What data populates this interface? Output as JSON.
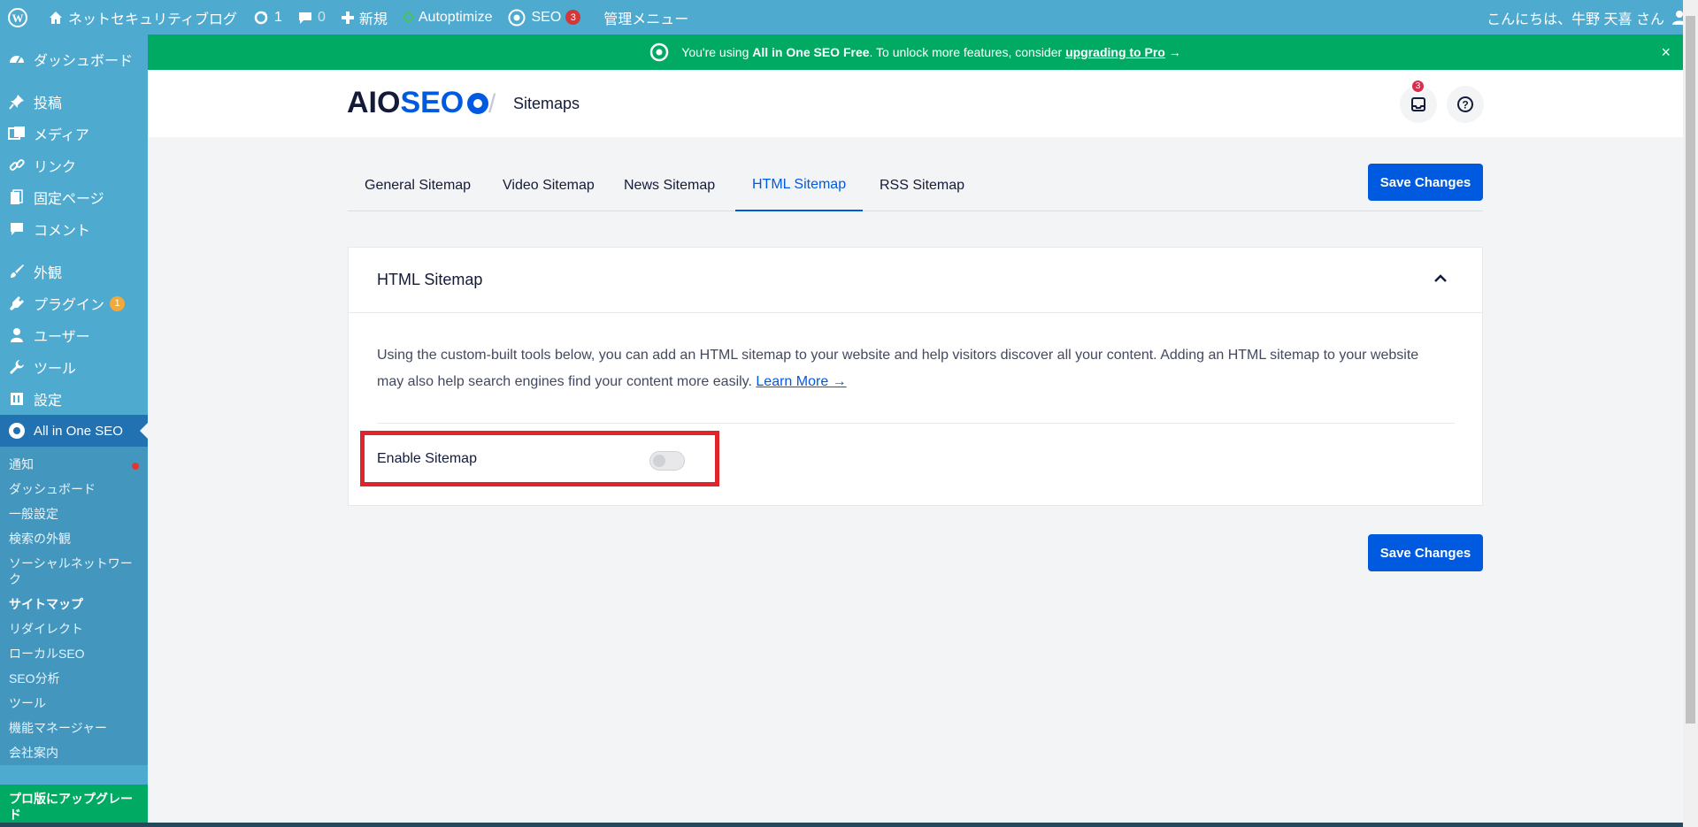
{
  "adminbar": {
    "site_name": "ネットセキュリティブログ",
    "updates_count": "1",
    "comments_count": "0",
    "new_label": "新規",
    "autoptimize_label": "Autoptimize",
    "seo_label": "SEO",
    "seo_badge": "3",
    "admin_menu_label": "管理メニュー",
    "greeting": "こんにちは、牛野 天喜 さん"
  },
  "sidebar": {
    "items": [
      {
        "label": "ダッシュボード",
        "icon": "dashboard-icon"
      },
      {
        "label": "投稿",
        "icon": "pin-icon"
      },
      {
        "label": "メディア",
        "icon": "media-icon"
      },
      {
        "label": "リンク",
        "icon": "link-icon"
      },
      {
        "label": "固定ページ",
        "icon": "page-icon"
      },
      {
        "label": "コメント",
        "icon": "comment-icon"
      },
      {
        "label": "外観",
        "icon": "brush-icon"
      },
      {
        "label": "プラグイン",
        "icon": "plugin-icon",
        "badge": "1"
      },
      {
        "label": "ユーザー",
        "icon": "user-icon"
      },
      {
        "label": "ツール",
        "icon": "wrench-icon"
      },
      {
        "label": "設定",
        "icon": "settings-icon"
      },
      {
        "label": "All in One SEO",
        "icon": "aioseo-icon"
      }
    ],
    "submenu": [
      "通知",
      "ダッシュボード",
      "一般設定",
      "検索の外観",
      "ソーシャルネットワーク",
      "サイトマップ",
      "リダイレクト",
      "ローカルSEO",
      "SEO分析",
      "ツール",
      "機能マネージャー",
      "会社案内"
    ],
    "upgrade_label": "プロ版にアップグレード"
  },
  "notice": {
    "prefix": "You're using ",
    "product": "All in One SEO Free",
    "middle": ". To unlock more features, consider ",
    "link": "upgrading to Pro",
    "arrow": " →",
    "close": "×"
  },
  "header": {
    "logo_aio": "AIO",
    "logo_seo": "SEO",
    "separator": "/",
    "title": "Sitemaps",
    "notifications_badge": "3"
  },
  "tabs": [
    "General Sitemap",
    "Video Sitemap",
    "News Sitemap",
    "HTML Sitemap",
    "RSS Sitemap"
  ],
  "active_tab": "HTML Sitemap",
  "save_label": "Save Changes",
  "card": {
    "title": "HTML Sitemap",
    "description": "Using the custom-built tools below, you can add an HTML sitemap to your website and help visitors discover all your content. Adding an HTML sitemap to your website may also help search engines find your content more easily.",
    "learn_more": "Learn More →",
    "enable_label": "Enable Sitemap",
    "enable_value": false
  },
  "colors": {
    "adminbar": "#4faad0",
    "notice": "#00aa63",
    "accent": "#005ae0",
    "highlight": "#e0242b"
  }
}
